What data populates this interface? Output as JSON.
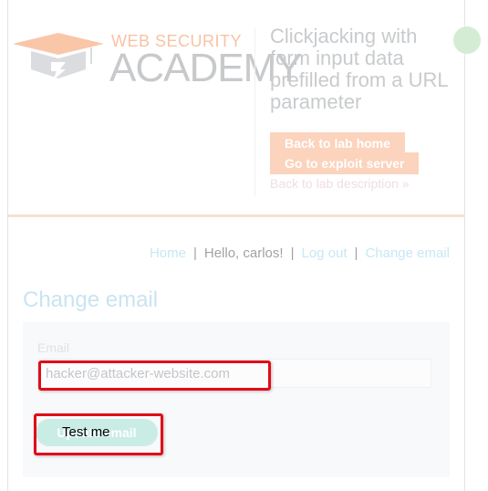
{
  "logo": {
    "top_text": "WEB SECURITY",
    "main_text": "ACADEMY"
  },
  "lab": {
    "title": "Clickjacking with form input data prefilled from a URL parameter",
    "back_home_label": "Back to lab home",
    "exploit_server_label": "Go to exploit server",
    "description_link": "Back to lab description",
    "description_arrow": "»"
  },
  "nav": {
    "home": "Home",
    "separator": "|",
    "greeting": "Hello, carlos!",
    "logout": "Log out",
    "change_email": "Change email"
  },
  "page": {
    "heading": "Change email"
  },
  "form": {
    "email_label": "Email",
    "email_value": "hacker@attacker-website.com",
    "submit_label": "Update email"
  },
  "decoy": {
    "label": "Test me"
  },
  "colors": {
    "brand_orange": "#fcd3bd",
    "overlay_red": "#e00d18",
    "link_blue": "#c9e7f5"
  }
}
